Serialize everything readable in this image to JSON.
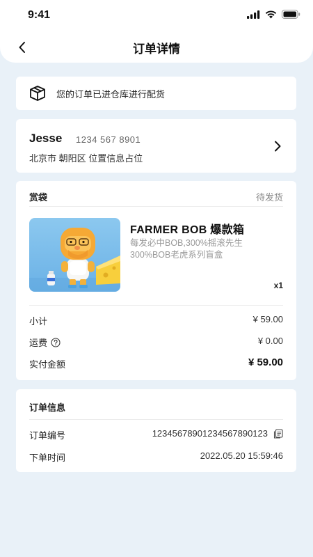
{
  "status_bar": {
    "time": "9:41"
  },
  "nav": {
    "title": "订单详情"
  },
  "notice": {
    "text": "您的订单已进仓库进行配货"
  },
  "address": {
    "name": "Jesse",
    "phone": "1234 567 8901",
    "detail": "北京市 朝阳区 位置信息占位"
  },
  "order": {
    "type": "赏袋",
    "status": "待发货",
    "product": {
      "title": "FARMER BOB 爆款箱",
      "desc_line1": "每发必中BOB,300%摇滚先生",
      "desc_line2": "300%BOB老虎系列盲盒",
      "qty": "x1"
    },
    "subtotal": {
      "label": "小计",
      "value": "¥ 59.00"
    },
    "shipping": {
      "label": "运费",
      "value": "¥ 0.00"
    },
    "total": {
      "label": "实付金额",
      "value": "¥ 59.00"
    }
  },
  "info": {
    "title": "订单信息",
    "order_no": {
      "label": "订单编号",
      "value": "12345678901234567890123"
    },
    "order_time": {
      "label": "下单时间",
      "value": "2022.05.20 15:59:46"
    }
  },
  "icons": [
    "signal-icon",
    "wifi-icon",
    "battery-icon",
    "back-arrow-icon",
    "package-box-icon",
    "chevron-right-icon",
    "help-circle-icon",
    "copy-icon"
  ],
  "colors": {
    "background": "#e9f1f8",
    "card": "#ffffff",
    "muted_text": "#999999",
    "status_text": "#888888"
  }
}
